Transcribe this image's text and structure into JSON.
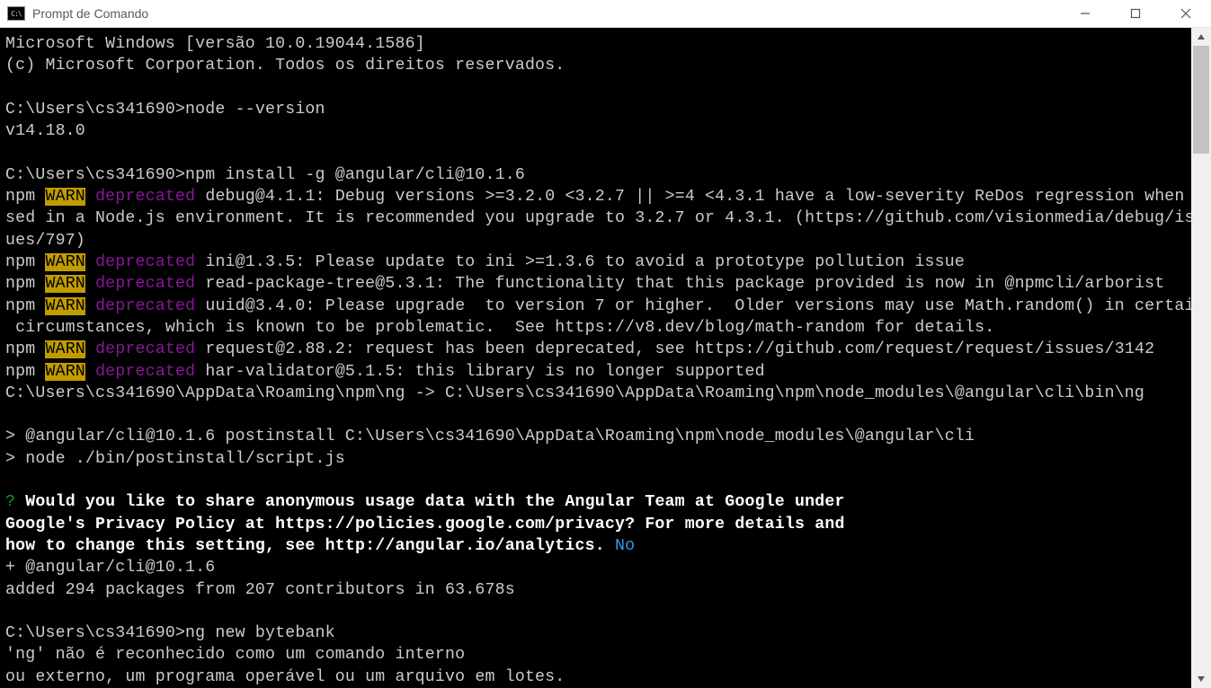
{
  "titlebar": {
    "icon_text": "C:\\",
    "title": "Prompt de Comando"
  },
  "window_controls": {
    "minimize": "minimize",
    "maximize": "maximize",
    "close": "close"
  },
  "term": {
    "l01": "Microsoft Windows [versão 10.0.19044.1586]",
    "l02": "(c) Microsoft Corporation. Todos os direitos reservados.",
    "l03": "",
    "l04": "C:\\Users\\cs341690>node --version",
    "l05": "v14.18.0",
    "l06": "",
    "l07": "C:\\Users\\cs341690>npm install -g @angular/cli@10.1.6",
    "w1_pre": "npm ",
    "w1_warn": "WARN",
    "w1_sp": " ",
    "w1_dep": "deprecated",
    "w1_msg": " debug@4.1.1: Debug versions >=3.2.0 <3.2.7 || >=4 <4.3.1 have a low-severity ReDos regression when u",
    "l09": "sed in a Node.js environment. It is recommended you upgrade to 3.2.7 or 4.3.1. (https://github.com/visionmedia/debug/iss",
    "l10": "ues/797)",
    "w2_pre": "npm ",
    "w2_warn": "WARN",
    "w2_sp": " ",
    "w2_dep": "deprecated",
    "w2_msg": " ini@1.3.5: Please update to ini >=1.3.6 to avoid a prototype pollution issue",
    "w3_pre": "npm ",
    "w3_warn": "WARN",
    "w3_sp": " ",
    "w3_dep": "deprecated",
    "w3_msg": " read-package-tree@5.3.1: The functionality that this package provided is now in @npmcli/arborist",
    "w4_pre": "npm ",
    "w4_warn": "WARN",
    "w4_sp": " ",
    "w4_dep": "deprecated",
    "w4_msg": " uuid@3.4.0: Please upgrade  to version 7 or higher.  Older versions may use Math.random() in certain",
    "l14": " circumstances, which is known to be problematic.  See https://v8.dev/blog/math-random for details.",
    "w5_pre": "npm ",
    "w5_warn": "WARN",
    "w5_sp": " ",
    "w5_dep": "deprecated",
    "w5_msg": " request@2.88.2: request has been deprecated, see https://github.com/request/request/issues/3142",
    "w6_pre": "npm ",
    "w6_warn": "WARN",
    "w6_sp": " ",
    "w6_dep": "deprecated",
    "w6_msg": " har-validator@5.1.5: this library is no longer supported",
    "l17": "C:\\Users\\cs341690\\AppData\\Roaming\\npm\\ng -> C:\\Users\\cs341690\\AppData\\Roaming\\npm\\node_modules\\@angular\\cli\\bin\\ng",
    "l18": "",
    "l19": "> @angular/cli@10.1.6 postinstall C:\\Users\\cs341690\\AppData\\Roaming\\npm\\node_modules\\@angular\\cli",
    "l20": "> node ./bin/postinstall/script.js",
    "l21": "",
    "q_mark": "?",
    "q_l1": " Would you like to share anonymous usage data with the Angular Team at Google under",
    "q_l2": "Google's Privacy Policy at https://policies.google.com/privacy? For more details and",
    "q_l3a": "how to change this setting, see http://angular.io/analytics. ",
    "q_ans": "No",
    "l25": "+ @angular/cli@10.1.6",
    "l26": "added 294 packages from 207 contributors in 63.678s",
    "l27": "",
    "l28": "C:\\Users\\cs341690>ng new bytebank",
    "l29": "'ng' não é reconhecido como um comando interno",
    "l30": "ou externo, um programa operável ou um arquivo em lotes."
  }
}
